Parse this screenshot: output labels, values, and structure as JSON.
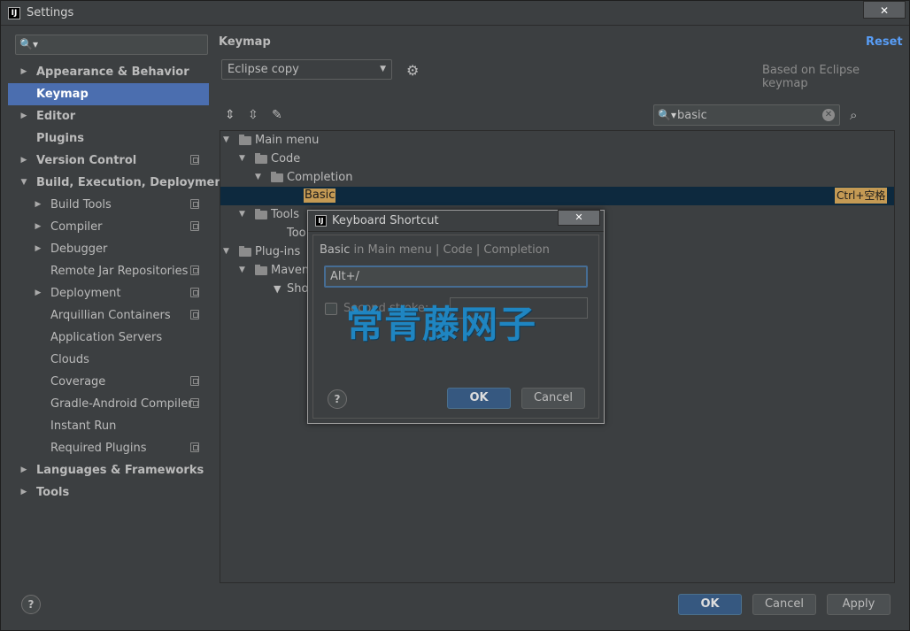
{
  "window": {
    "title": "Settings",
    "close_glyph": "✕",
    "app_icon": "intellij-icon",
    "app_icon_text": "IJ"
  },
  "sidebar": {
    "search_placeholder": "",
    "items": [
      {
        "label": "Appearance & Behavior",
        "level": 0,
        "expandable": true,
        "expanded": false,
        "bold": true
      },
      {
        "label": "Keymap",
        "level": 0,
        "expandable": false,
        "bold": true,
        "selected": true
      },
      {
        "label": "Editor",
        "level": 0,
        "expandable": true,
        "expanded": false,
        "bold": true
      },
      {
        "label": "Plugins",
        "level": 0,
        "expandable": false,
        "bold": true
      },
      {
        "label": "Version Control",
        "level": 0,
        "expandable": true,
        "expanded": false,
        "bold": true,
        "project_icon": true
      },
      {
        "label": "Build, Execution, Deployment",
        "level": 0,
        "expandable": true,
        "expanded": true,
        "bold": true
      },
      {
        "label": "Build Tools",
        "level": 1,
        "expandable": true,
        "project_icon": true
      },
      {
        "label": "Compiler",
        "level": 1,
        "expandable": true,
        "project_icon": true
      },
      {
        "label": "Debugger",
        "level": 1,
        "expandable": true
      },
      {
        "label": "Remote Jar Repositories",
        "level": 1,
        "project_icon": true
      },
      {
        "label": "Deployment",
        "level": 1,
        "expandable": true,
        "project_icon": true
      },
      {
        "label": "Arquillian Containers",
        "level": 1,
        "project_icon": true
      },
      {
        "label": "Application Servers",
        "level": 1
      },
      {
        "label": "Clouds",
        "level": 1
      },
      {
        "label": "Coverage",
        "level": 1,
        "project_icon": true
      },
      {
        "label": "Gradle-Android Compiler",
        "level": 1,
        "project_icon": true
      },
      {
        "label": "Instant Run",
        "level": 1
      },
      {
        "label": "Required Plugins",
        "level": 1,
        "project_icon": true
      },
      {
        "label": "Languages & Frameworks",
        "level": 0,
        "expandable": true,
        "expanded": false,
        "bold": true
      },
      {
        "label": "Tools",
        "level": 0,
        "expandable": true,
        "expanded": false,
        "bold": true
      }
    ]
  },
  "keymap": {
    "heading": "Keymap",
    "reset_label": "Reset",
    "scheme_value": "Eclipse copy",
    "based_on": "Based on Eclipse keymap",
    "filter_value": "basic",
    "tree": [
      {
        "label": "Main menu",
        "level": 0,
        "expanded": true,
        "icon": "menu-folder-icon"
      },
      {
        "label": "Code",
        "level": 1,
        "expanded": true,
        "icon": "folder-icon"
      },
      {
        "label": "Completion",
        "level": 2,
        "expanded": true,
        "icon": "folder-icon"
      },
      {
        "label": "Basic",
        "level": 3,
        "selected": true,
        "highlight": true,
        "shortcut": "Ctrl+空格"
      },
      {
        "label": "Tools",
        "level": 1,
        "expanded": true,
        "icon": "folder-icon"
      },
      {
        "label": "Too",
        "level": 2,
        "icon": "none"
      },
      {
        "label": "Plug-ins",
        "level": 0,
        "expanded": true,
        "icon": "folder-icon"
      },
      {
        "label": "Maven",
        "level": 1,
        "expanded": true,
        "icon": "folder-icon"
      },
      {
        "label": "Sho",
        "level": 2,
        "icon": "filter-icon"
      }
    ]
  },
  "dialog": {
    "title": "Keyboard Shortcut",
    "path_action": "Basic",
    "path_rest": " in Main menu | Code | Completion",
    "shortcut_value": "Alt+/",
    "second_stroke_label": "Second stroke:",
    "ok_label": "OK",
    "cancel_label": "Cancel",
    "help_label": "?"
  },
  "footer": {
    "help_label": "?",
    "ok_label": "OK",
    "cancel_label": "Cancel",
    "apply_label": "Apply"
  },
  "watermark": "常青藤网子",
  "colors": {
    "selection": "#4b6eaf",
    "tree_selection": "#0d293e",
    "search_highlight": "#c49a54",
    "link": "#589df6",
    "watermark": "#1d8ccc"
  }
}
